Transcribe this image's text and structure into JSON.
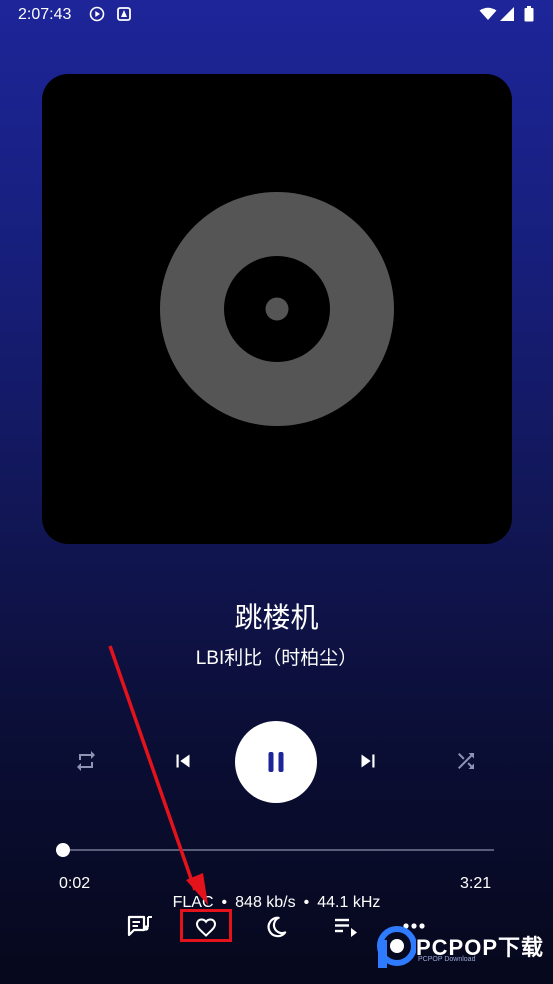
{
  "status_bar": {
    "time": "2:07:43",
    "icons": [
      "play-circle-icon",
      "notification-icon",
      "wifi-icon",
      "signal-icon",
      "battery-icon"
    ]
  },
  "album_art": {
    "placeholder_icon": "vinyl-disc-icon"
  },
  "song": {
    "title": "跳楼机",
    "artist": "LBI利比（时柏尘）"
  },
  "controls": {
    "repeat": "repeat-icon",
    "previous": "skip-previous-icon",
    "play_pause": "pause-icon",
    "next": "skip-next-icon",
    "shuffle": "shuffle-icon"
  },
  "progress": {
    "elapsed": "0:02",
    "total": "3:21",
    "fraction": 0.01
  },
  "format": {
    "codec": "FLAC",
    "bitrate": "848 kb/s",
    "sample_rate": "44.1 kHz",
    "separator": "•"
  },
  "actions": {
    "lyrics": "lyrics-icon",
    "favorite": "heart-outline-icon",
    "sleep_timer": "moon-icon",
    "queue": "queue-music-icon",
    "more": "more-dots-icon"
  },
  "watermark": {
    "brand": "PCPOP下载",
    "sub": "PCPOP Download"
  },
  "colors": {
    "background_top": "#1d2599",
    "background_bottom": "#06081c",
    "disc_gray": "#555555",
    "pause_icon": "#1d2599",
    "annotation_red": "#e3121b"
  }
}
